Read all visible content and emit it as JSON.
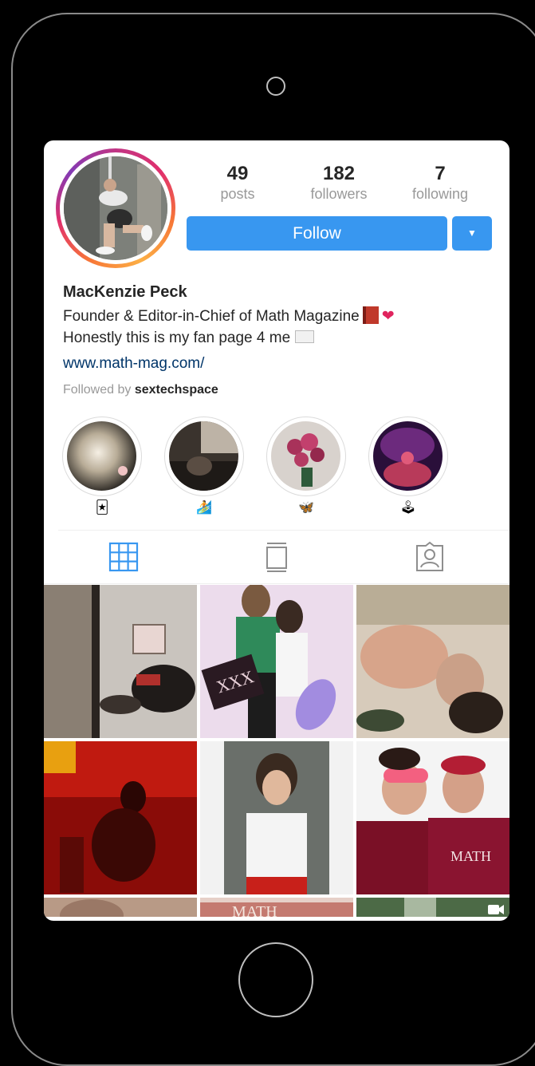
{
  "profile": {
    "name": "MacKenzie Peck",
    "bio_line_1": "Founder & Editor-in-Chief of Math Magazine",
    "bio_line_2": "Honestly this is my fan page 4 me",
    "website": "www.math-mag.com/",
    "followed_by_prefix": "Followed by",
    "followed_by_user": "sextechspace"
  },
  "stats": {
    "posts": {
      "value": "49",
      "label": "posts"
    },
    "followers": {
      "value": "182",
      "label": "followers"
    },
    "following": {
      "value": "7",
      "label": "following"
    }
  },
  "actions": {
    "follow_label": "Follow",
    "dropdown_glyph": "▼"
  },
  "highlights": [
    {
      "emoji": "🃏"
    },
    {
      "emoji": "🏄"
    },
    {
      "emoji": "🦋"
    },
    {
      "emoji": "🕹"
    }
  ],
  "tabs": [
    {
      "name": "grid-view",
      "active": true
    },
    {
      "name": "feed-view",
      "active": false
    },
    {
      "name": "tagged-view",
      "active": false
    }
  ],
  "colors": {
    "follow_button": "#3897f0",
    "active_tab": "#3897f0",
    "inactive_tab": "#8e8e8e",
    "link": "#003569",
    "muted": "#999999"
  }
}
